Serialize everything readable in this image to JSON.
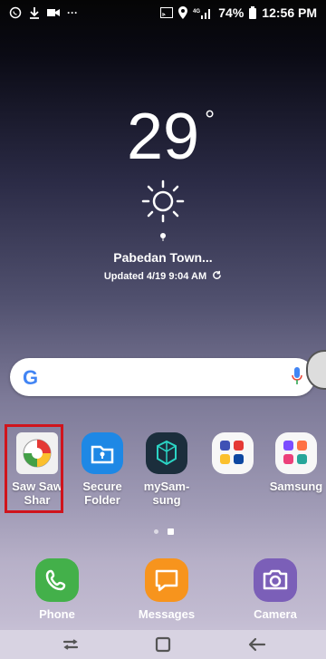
{
  "status_bar": {
    "left_icons": [
      "whatsapp-icon",
      "download-icon",
      "video-icon",
      "more-icon"
    ],
    "right_icons": [
      "cast-icon",
      "location-icon",
      "signal-icon"
    ],
    "battery": "74%",
    "time": "12:56 PM"
  },
  "weather": {
    "temperature": "29",
    "degree_symbol": "°",
    "condition_icon": "sun-icon",
    "location": "Pabedan Town...",
    "updated": "Updated 4/19 9:04 AM"
  },
  "search": {
    "logo": "G",
    "mic_icon": "mic-icon"
  },
  "apps": [
    {
      "label": "Saw Saw\nShar",
      "icon": "saw-saw-shar-icon",
      "highlighted": true
    },
    {
      "label": "Secure\nFolder",
      "icon": "secure-folder-icon"
    },
    {
      "label": "mySam-\nsung",
      "icon": "mysamsung-icon"
    },
    {
      "label": "",
      "icon": "folder-icon"
    },
    {
      "label": "Samsung",
      "icon": "samsung-folder-icon"
    }
  ],
  "dock": [
    {
      "label": "Phone",
      "icon": "phone-icon"
    },
    {
      "label": "Messages",
      "icon": "messages-icon"
    },
    {
      "label": "Camera",
      "icon": "camera-icon"
    }
  ],
  "colors": {
    "highlight": "#d0141c",
    "phone_green": "#43b04a",
    "messages_orange": "#f7941d",
    "camera_purple": "#7b5fb8",
    "secure_blue": "#1e88e5"
  }
}
